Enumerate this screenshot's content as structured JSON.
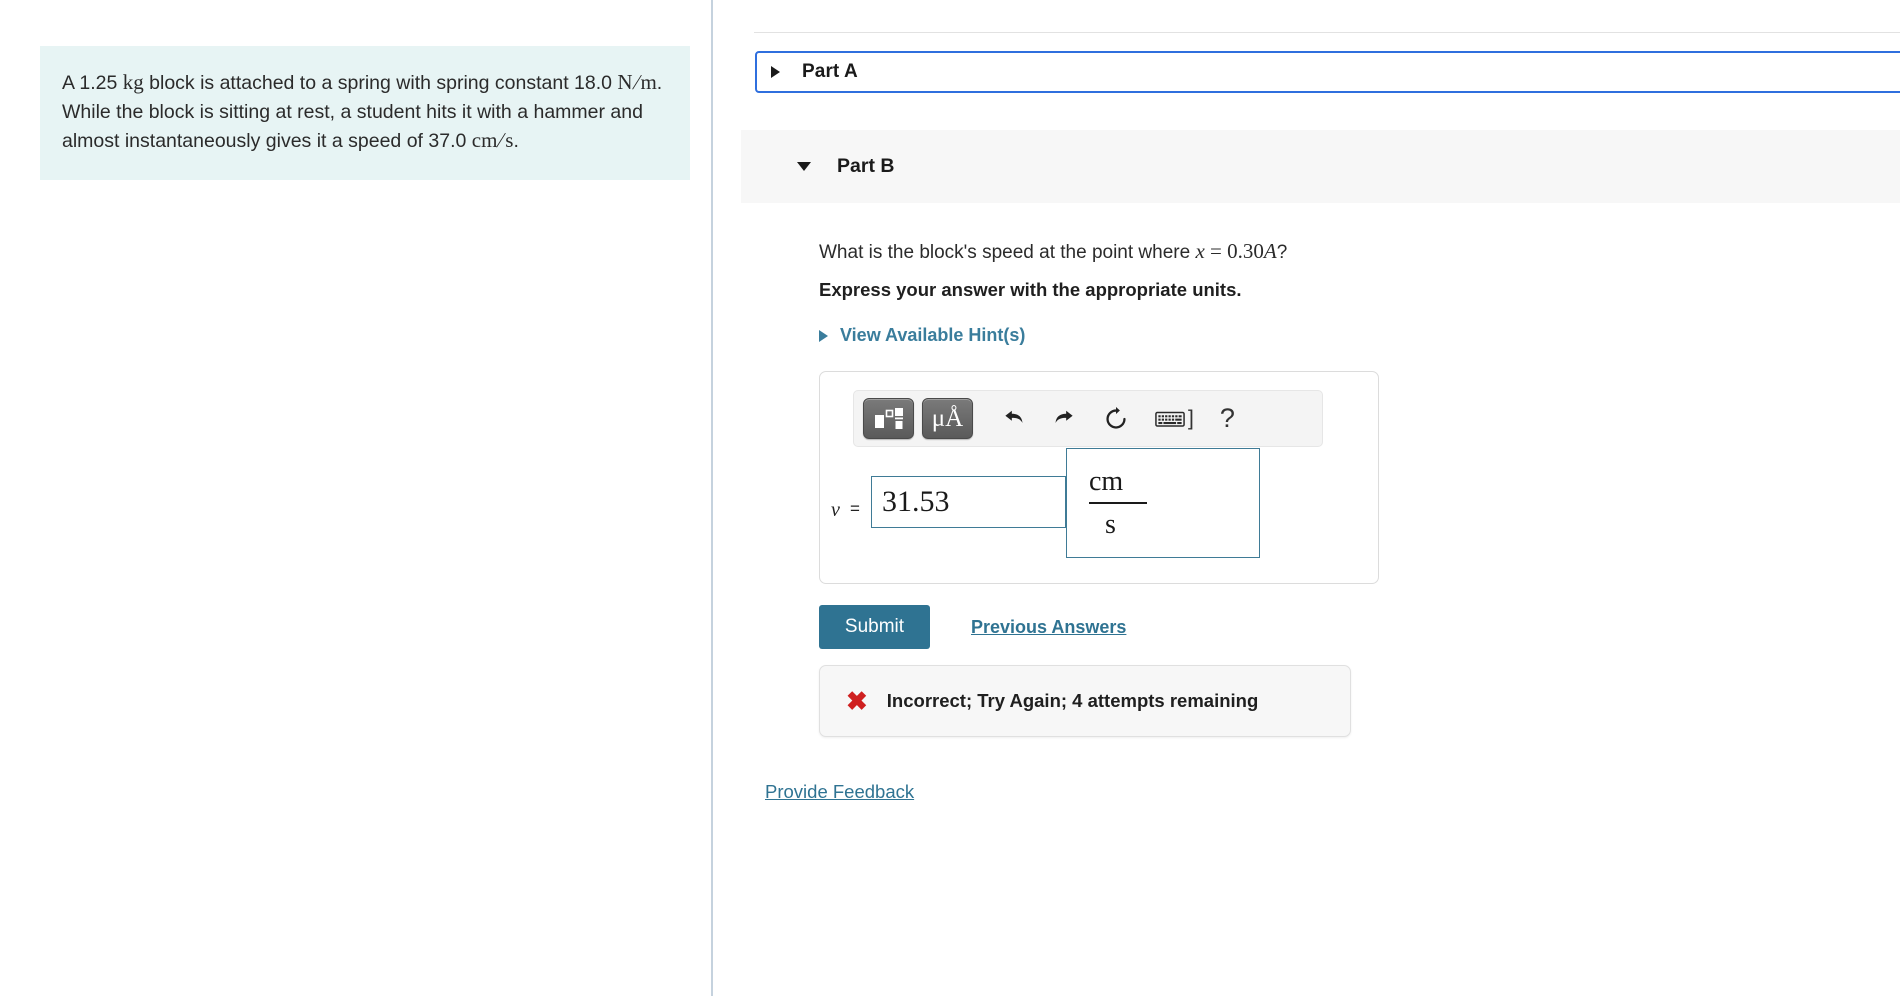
{
  "problem": {
    "text_parts": [
      "A 1.25 ",
      "kg",
      " block is attached to a spring with spring constant 18.0 ",
      "N/m",
      ". While the block is sitting at rest, a student hits it with a hammer and almost instantaneously gives it a speed of 37.0 ",
      "cm/s",
      "."
    ],
    "mass": "1.25",
    "mass_unit": "kg",
    "spring_constant": "18.0",
    "spring_constant_unit": "N/m",
    "speed": "37.0",
    "speed_unit": "cm/s",
    "line1_a": "A 1.25 ",
    "line1_unit_num": "kg",
    "line1_b": " block is attached to a spring with spring constant",
    "line2_a": "18.0 ",
    "line2_unit_n": "N",
    "line2_unit_slash": "/",
    "line2_unit_m": "m",
    "line2_b": ". While the block is sitting at rest, a student hits it with a",
    "line3": "hammer and almost instantaneously gives it a speed of",
    "line4_a": "37.0 ",
    "line4_unit_cm": "cm",
    "line4_unit_slash": "/",
    "line4_unit_s": "s",
    "line4_b": "."
  },
  "parts": {
    "part_a": {
      "label": "Part A",
      "expanded": "false",
      "toggle_icon": "triangle-right-icon"
    },
    "part_b": {
      "label": "Part B",
      "expanded": "true",
      "toggle_icon": "triangle-down-icon"
    }
  },
  "question": {
    "prefix": "What is the block's speed at the point where ",
    "math_x": "x",
    "math_eq": " = ",
    "math_value": "0.30",
    "math_amp": "A",
    "suffix": "?",
    "instruction": "Express your answer with the appropriate units."
  },
  "hints": {
    "label": "View Available Hint(s)",
    "icon": "triangle-right-icon"
  },
  "toolbar": {
    "template_button": {
      "name": "template-button",
      "title": "templates-and-symbols"
    },
    "units_button": {
      "name": "units-button",
      "label": "μÅ"
    },
    "undo": "undo-icon",
    "redo": "redo-icon",
    "reset": "reset-icon",
    "keyboard": "keyboard-icon",
    "keyboard_bracket": "]",
    "help": "?"
  },
  "answer": {
    "variable": "v",
    "equals": "=",
    "value": "31.53",
    "placeholder": "",
    "units_numerator": "cm",
    "units_denominator": "s"
  },
  "actions": {
    "submit_label": "Submit",
    "previous_answers_label": "Previous Answers",
    "provide_feedback_label": "Provide Feedback"
  },
  "feedback": {
    "icon": "red-x-icon",
    "icon_glyph": "✖",
    "message": "Incorrect; Try Again; 4 attempts remaining",
    "attempts_remaining": "4"
  },
  "colors": {
    "problem_box_bg": "#e7f4f4",
    "part_a_border": "#2f6fde",
    "part_b_header_bg": "#f7f7f7",
    "link_teal": "#3a7d9c",
    "submit_bg": "#2f7392",
    "error_red": "#cf2020",
    "divider": "#c5d2de"
  }
}
